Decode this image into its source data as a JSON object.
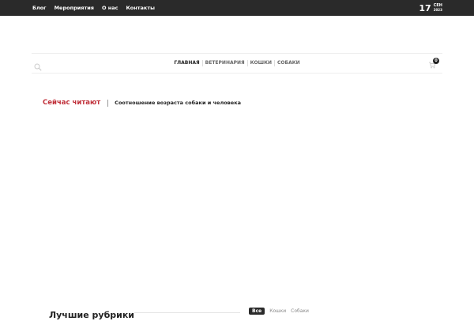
{
  "topbar": {
    "nav": [
      "Блог",
      "Мероприятия",
      "О нас",
      "Контакты"
    ],
    "date": {
      "day": "17",
      "month": "СЕН",
      "year": "2023"
    }
  },
  "main_nav": {
    "items": [
      "Главная",
      "Ветеринария",
      "Кошки",
      "Собаки"
    ],
    "active": "Главная",
    "cart_count": "0"
  },
  "now_reading": {
    "label": "Сейчас читают",
    "title": "Соотношение возраста собаки и человека"
  },
  "best_categories": {
    "title": "Лучшие рубрики",
    "filters": [
      "Все",
      "Кошки",
      "Собаки"
    ],
    "active_filter": "Все"
  },
  "colors": {
    "topbar_bg": "#2a2a2a",
    "accent_red": "#c0303a"
  }
}
